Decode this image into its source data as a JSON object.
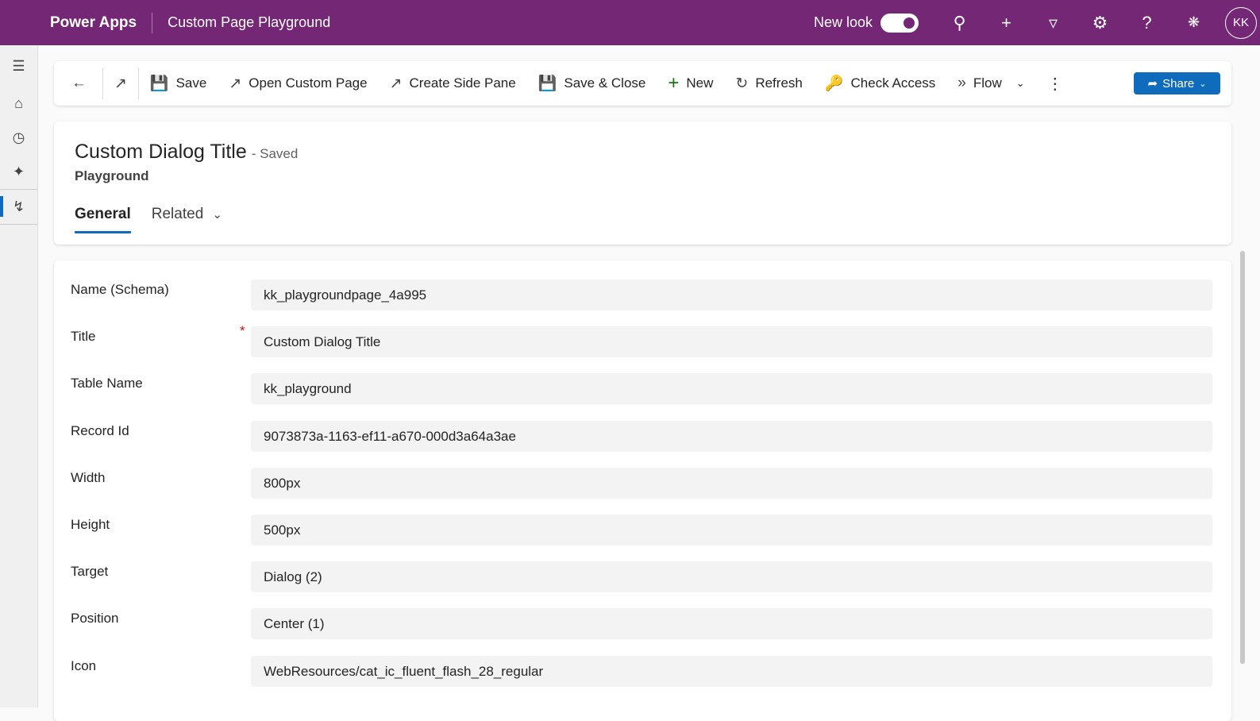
{
  "header": {
    "brand": "Power Apps",
    "app_title": "Custom Page Playground",
    "new_look_label": "New look",
    "new_look_on": true,
    "avatar_initials": "KK",
    "accent": "#742774"
  },
  "nav": {
    "items": [
      "menu",
      "home",
      "recent",
      "pinned",
      "custom-page"
    ]
  },
  "commands": {
    "save": "Save",
    "open_custom_page": "Open Custom Page",
    "create_side_pane": "Create Side Pane",
    "save_close": "Save & Close",
    "new": "New",
    "refresh": "Refresh",
    "check_access": "Check Access",
    "flow": "Flow",
    "share": "Share"
  },
  "record": {
    "title": "Custom Dialog Title",
    "status": "- Saved",
    "entity": "Playground"
  },
  "tabs": {
    "general": "General",
    "related": "Related"
  },
  "fields": [
    {
      "label": "Name (Schema)",
      "value": "kk_playgroundpage_4a995",
      "required": false
    },
    {
      "label": "Title",
      "value": "Custom Dialog Title",
      "required": true
    },
    {
      "label": "Table Name",
      "value": "kk_playground",
      "required": false
    },
    {
      "label": "Record Id",
      "value": "9073873a-1163-ef11-a670-000d3a64a3ae",
      "required": false
    },
    {
      "label": "Width",
      "value": "800px",
      "required": false
    },
    {
      "label": "Height",
      "value": "500px",
      "required": false
    },
    {
      "label": "Target",
      "value": "Dialog (2)",
      "required": false
    },
    {
      "label": "Position",
      "value": "Center (1)",
      "required": false
    },
    {
      "label": "Icon",
      "value": "WebResources/cat_ic_fluent_flash_28_regular",
      "required": false
    }
  ],
  "required_marker": "*"
}
